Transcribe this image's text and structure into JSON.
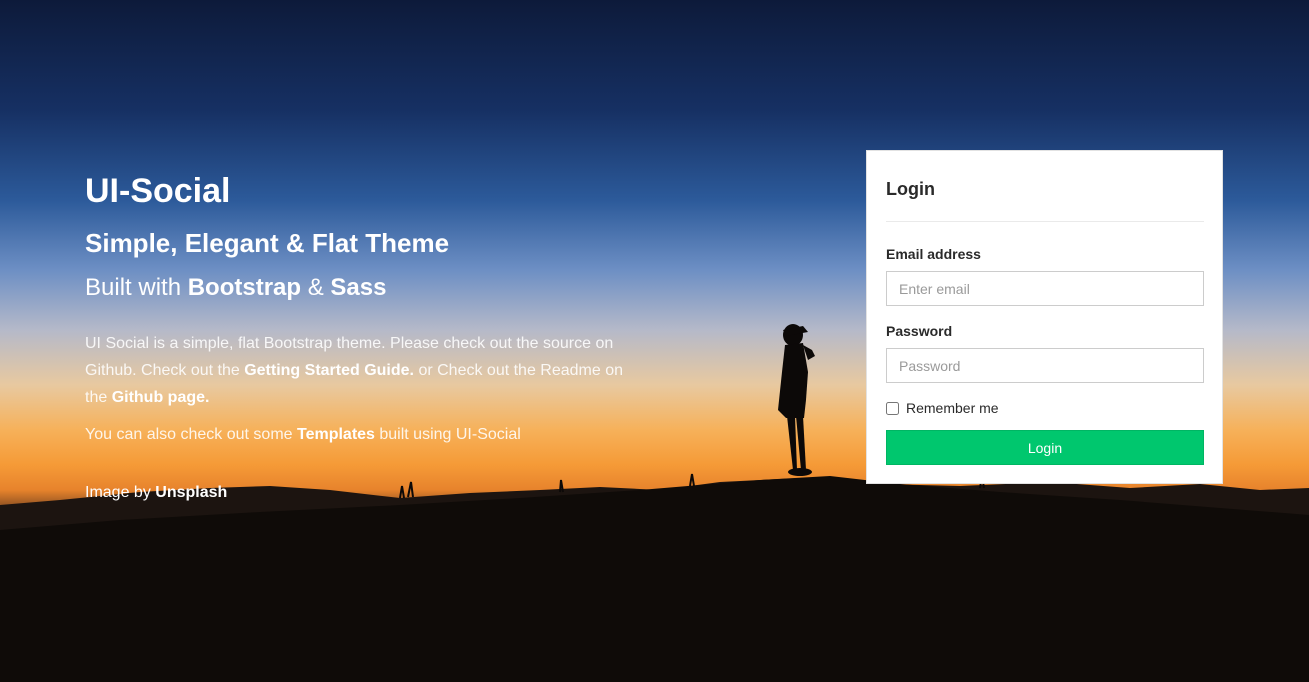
{
  "hero": {
    "title": "UI-Social",
    "subtitle": "Simple, Elegant & Flat Theme",
    "built_prefix": "Built with ",
    "built_bootstrap": "Bootstrap",
    "built_amp": " & ",
    "built_sass": "Sass",
    "desc_part1": "UI Social is a simple, flat Bootstrap theme. Please check out the source on Github. Check out the ",
    "desc_link1": "Getting Started Guide.",
    "desc_part2": " or Check out the Readme on the ",
    "desc_link2": "Github page.",
    "templates_prefix": "You can also check out some ",
    "templates_link": "Templates",
    "templates_suffix": " built using UI-Social",
    "credit_prefix": "Image by ",
    "credit_link": "Unsplash"
  },
  "login": {
    "title": "Login",
    "email_label": "Email address",
    "email_placeholder": "Enter email",
    "email_value": "",
    "password_label": "Password",
    "password_placeholder": "Password",
    "password_value": "",
    "remember_label": "Remember me",
    "remember_checked": false,
    "button_label": "Login"
  },
  "colors": {
    "button_green": "#00c76e",
    "card_bg": "#ffffff"
  }
}
